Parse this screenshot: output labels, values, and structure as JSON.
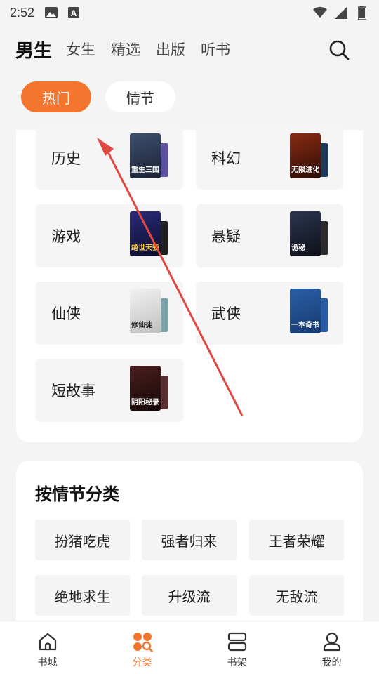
{
  "status_bar": {
    "time": "2:52",
    "left_icons": [
      "image-icon",
      "a-letter-icon"
    ],
    "right_icons": [
      "wifi-icon",
      "signal-icon",
      "battery-icon"
    ]
  },
  "top_tabs": [
    {
      "label": "男生",
      "active": true
    },
    {
      "label": "女生",
      "active": false
    },
    {
      "label": "精选",
      "active": false
    },
    {
      "label": "出版",
      "active": false
    },
    {
      "label": "听书",
      "active": false
    }
  ],
  "chips": [
    {
      "label": "热门",
      "active": true
    },
    {
      "label": "情节",
      "active": false
    }
  ],
  "categories": [
    {
      "label": "历史",
      "cover_text": "重生三国",
      "cover_color": "#2a3a55",
      "back_color": "#5a4fa0"
    },
    {
      "label": "科幻",
      "cover_text": "无限进化",
      "cover_color": "#6b1f12",
      "back_color": "#1d3a5a"
    },
    {
      "label": "游戏",
      "cover_text": "绝世天骄",
      "cover_color": "#1a1a4a",
      "back_color": "#222"
    },
    {
      "label": "悬疑",
      "cover_text": "诡秘",
      "cover_color": "#1b2030",
      "back_color": "#2c2c2c"
    },
    {
      "label": "仙侠",
      "cover_text": "修仙徒",
      "cover_color": "#e8e8e8",
      "back_color": "#7aa3a8"
    },
    {
      "label": "武侠",
      "cover_text": "一本奇书",
      "cover_color": "#1f4a8c",
      "back_color": "#2a5aa5"
    },
    {
      "label": "短故事",
      "cover_text": "阴阳秘录",
      "cover_color": "#3a1616",
      "back_color": "#5a2e2e"
    }
  ],
  "plot_section": {
    "title": "按情节分类",
    "items": [
      "扮猪吃虎",
      "强者归来",
      "王者荣耀",
      "绝地求生",
      "升级流",
      "无敌流"
    ]
  },
  "bottom_nav": [
    {
      "label": "书城",
      "icon": "home-icon",
      "active": false
    },
    {
      "label": "分类",
      "icon": "category-icon",
      "active": true
    },
    {
      "label": "书架",
      "icon": "bookshelf-icon",
      "active": false
    },
    {
      "label": "我的",
      "icon": "profile-icon",
      "active": false
    }
  ],
  "colors": {
    "accent": "#f4762e",
    "annotation_arrow": "#e0473f"
  }
}
